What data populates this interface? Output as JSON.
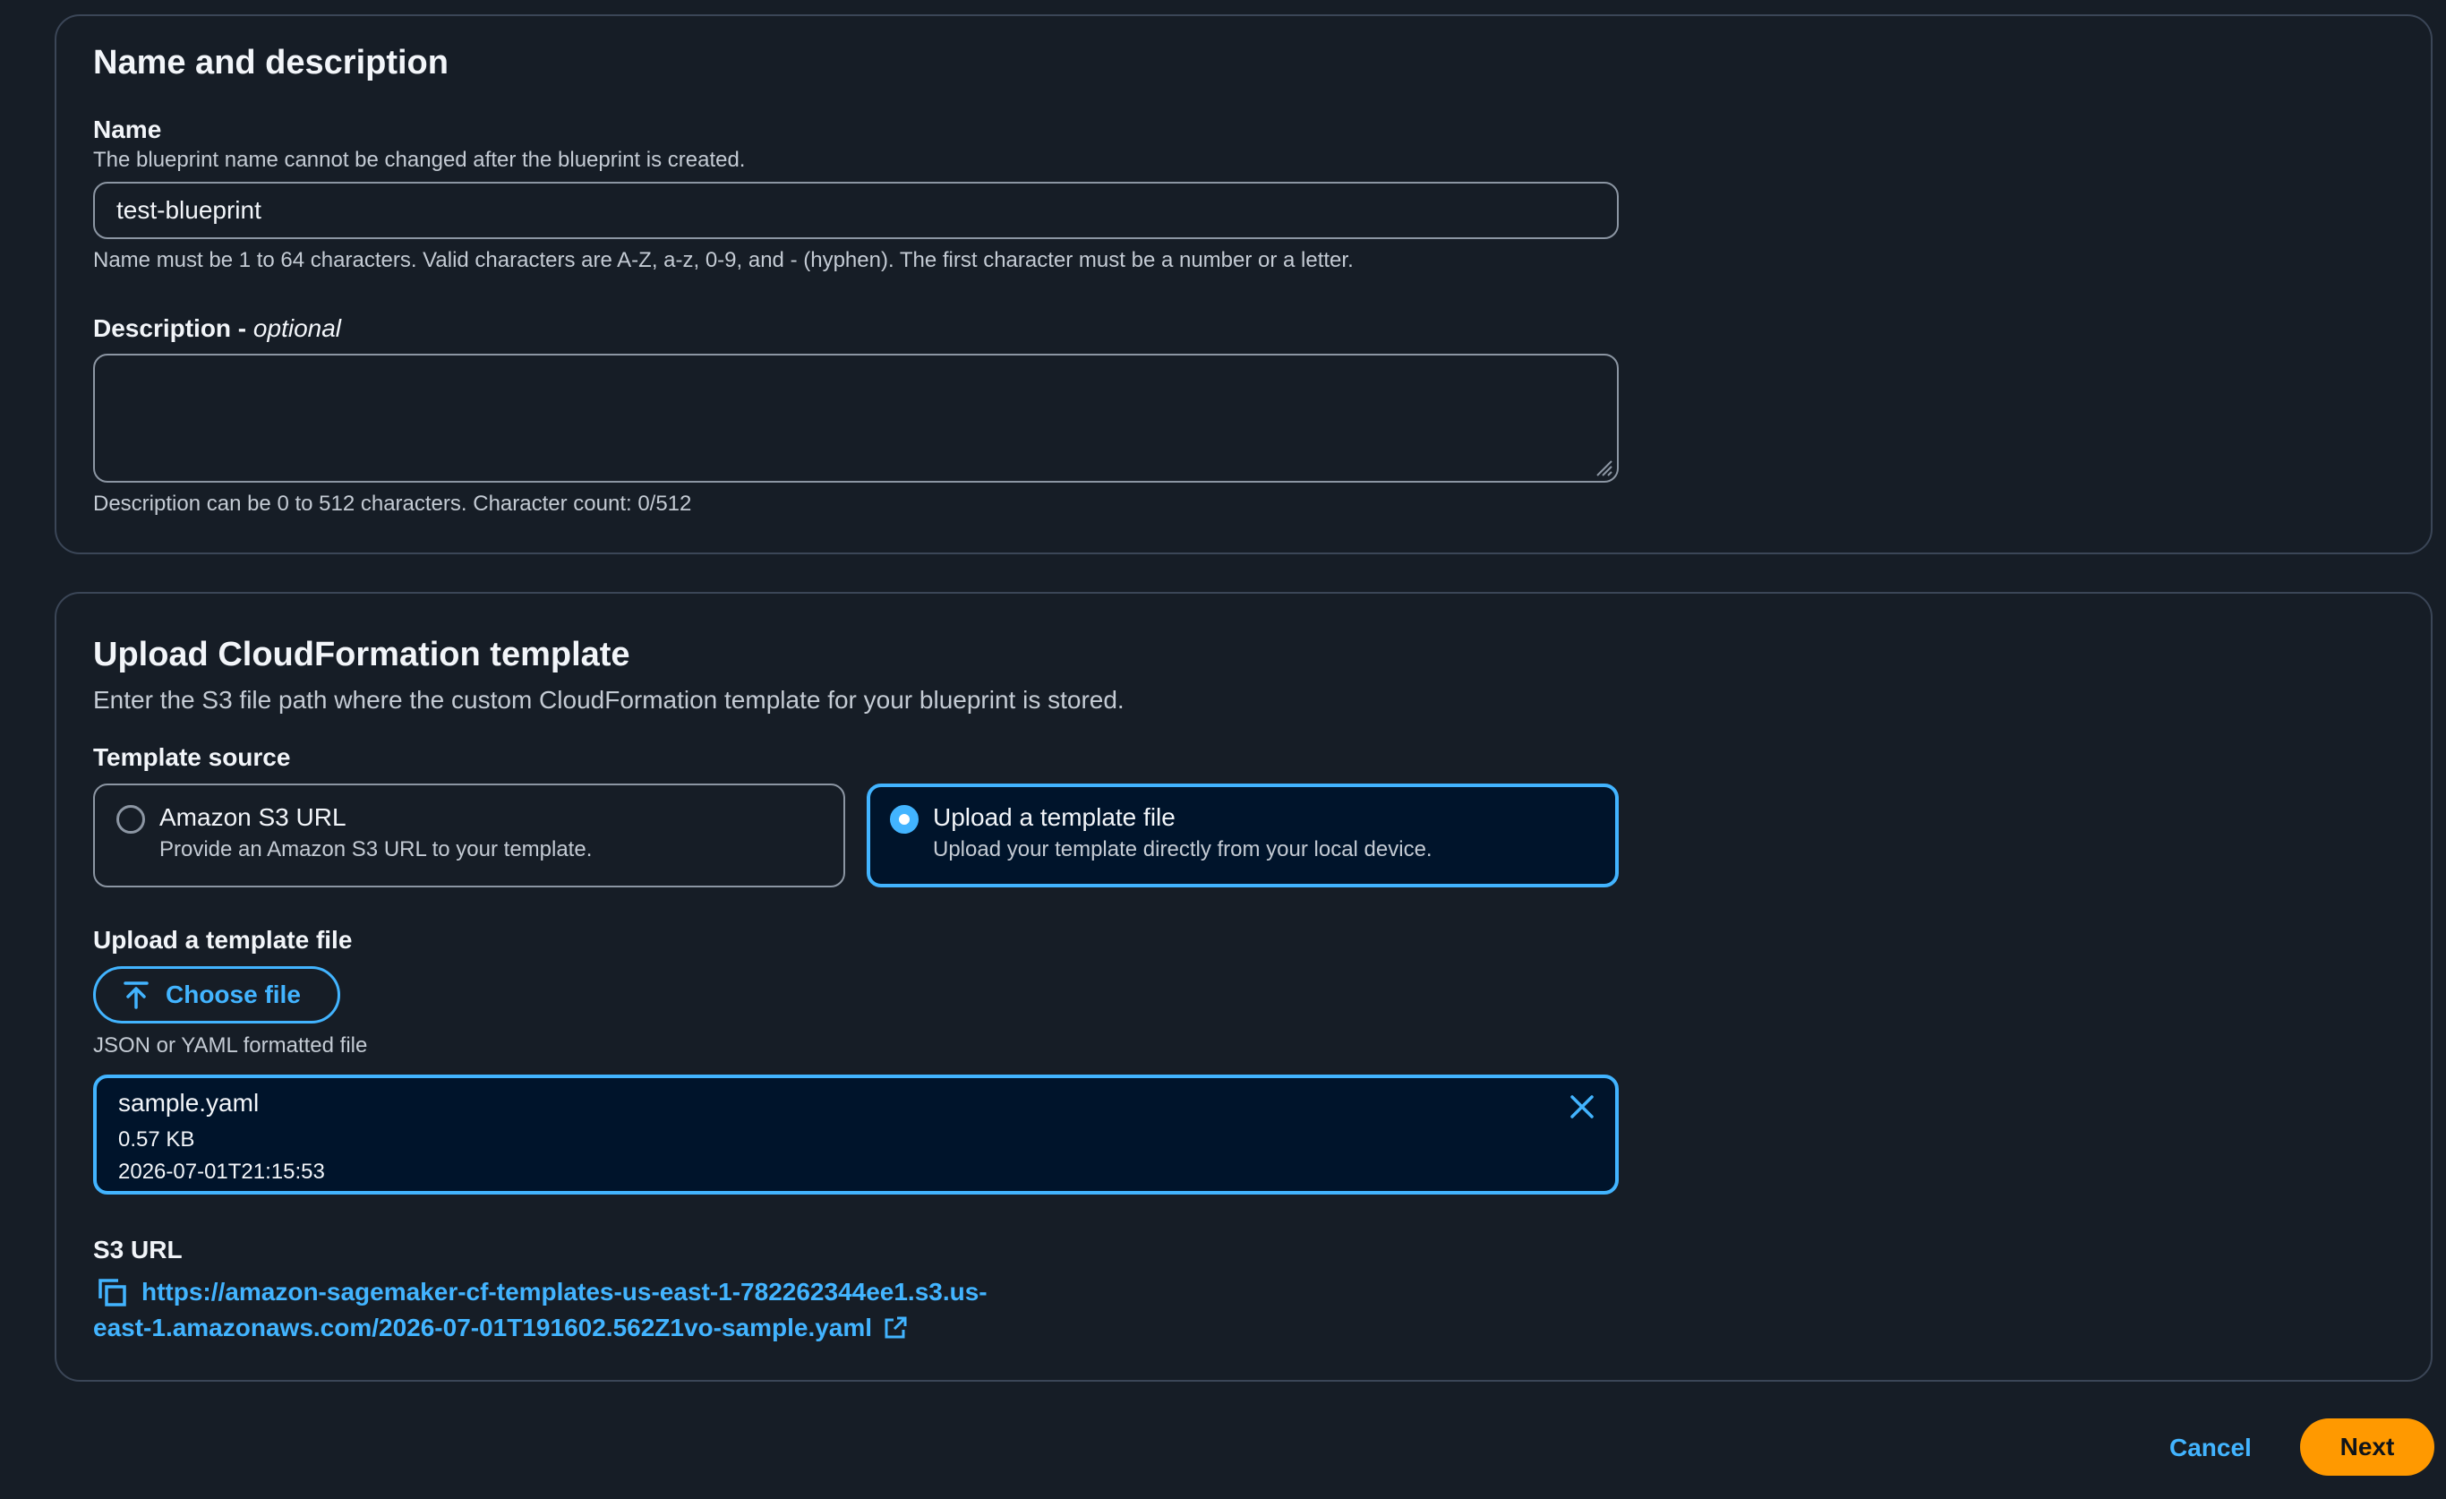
{
  "name_section": {
    "title": "Name and description",
    "name_label": "Name",
    "name_description": "The blueprint name cannot be changed after the blueprint is created.",
    "name_value": "test-blueprint",
    "name_constraint": "Name must be 1 to 64 characters. Valid characters are A-Z, a-z, 0-9, and - (hyphen). The first character must be a number or a letter.",
    "description_label": "Description -",
    "description_optional": "optional",
    "description_value": "",
    "description_constraint": "Description can be 0 to 512 characters. Character count: 0/512"
  },
  "upload_section": {
    "title": "Upload CloudFormation template",
    "subtitle": "Enter the S3 file path where the custom CloudFormation template for your blueprint is stored.",
    "template_source_label": "Template source",
    "options": [
      {
        "title": "Amazon S3 URL",
        "description": "Provide an Amazon S3 URL to your template.",
        "selected": false
      },
      {
        "title": "Upload a template file",
        "description": "Upload your template directly from your local device.",
        "selected": true
      }
    ],
    "upload_label": "Upload a template file",
    "choose_file_label": "Choose file",
    "file_hint": "JSON or YAML formatted file",
    "file": {
      "name": "sample.yaml",
      "size": "0.57 KB",
      "modified": "2026-07-01T21:15:53"
    },
    "s3_url_label": "S3 URL",
    "s3_url_line1": "https://amazon-sagemaker-cf-templates-us-east-1-782262344ee1.s3.us-",
    "s3_url_line2": "east-1.amazonaws.com/2026-07-01T191602.562Z1vo-sample.yaml"
  },
  "footer": {
    "cancel_label": "Cancel",
    "next_label": "Next"
  },
  "colors": {
    "background": "#161d26",
    "accent": "#42b4ff",
    "primary_button": "#ff9900",
    "selected_tile": "#00142b"
  },
  "icons": [
    "resize-grip-icon",
    "upload-icon",
    "close-icon",
    "copy-icon",
    "external-link-icon"
  ]
}
